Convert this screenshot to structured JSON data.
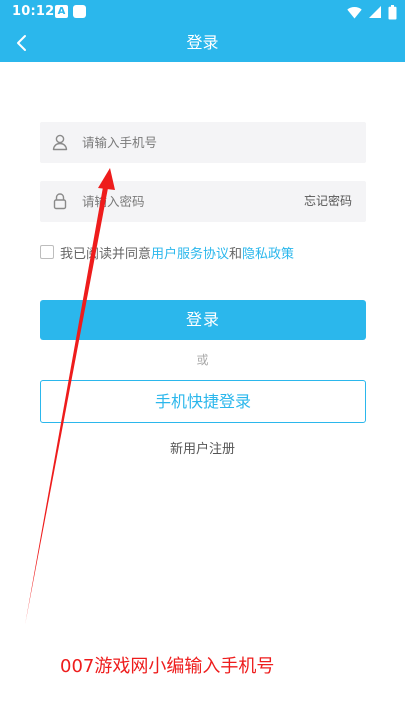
{
  "status_bar": {
    "time": "10:12",
    "notification_glyph": "A",
    "icons": [
      "app-a-icon",
      "square-app-icon",
      "wifi-icon",
      "signal-icon",
      "battery-icon"
    ]
  },
  "header": {
    "title": "登录",
    "back_icon": "chevron-left-icon"
  },
  "login_form": {
    "phone": {
      "placeholder": "请输入手机号",
      "value": "",
      "icon": "user-icon"
    },
    "password": {
      "placeholder": "请输入密码",
      "value": "",
      "icon": "lock-icon",
      "forgot_label": "忘记密码"
    },
    "agreement": {
      "checked": false,
      "prefix": "我已阅读并同意",
      "user_agreement": "用户服务协议",
      "conjunction": "和",
      "privacy_policy": "隐私政策"
    },
    "login_button": "登录",
    "or_text": "或",
    "quick_login_button": "手机快捷登录",
    "register_link": "新用户注册"
  },
  "annotation": {
    "caption": "007游戏网小编输入手机号",
    "color": "#ee1c1c"
  },
  "colors": {
    "accent": "#2bb7ec",
    "field_bg": "#f4f4f6"
  }
}
